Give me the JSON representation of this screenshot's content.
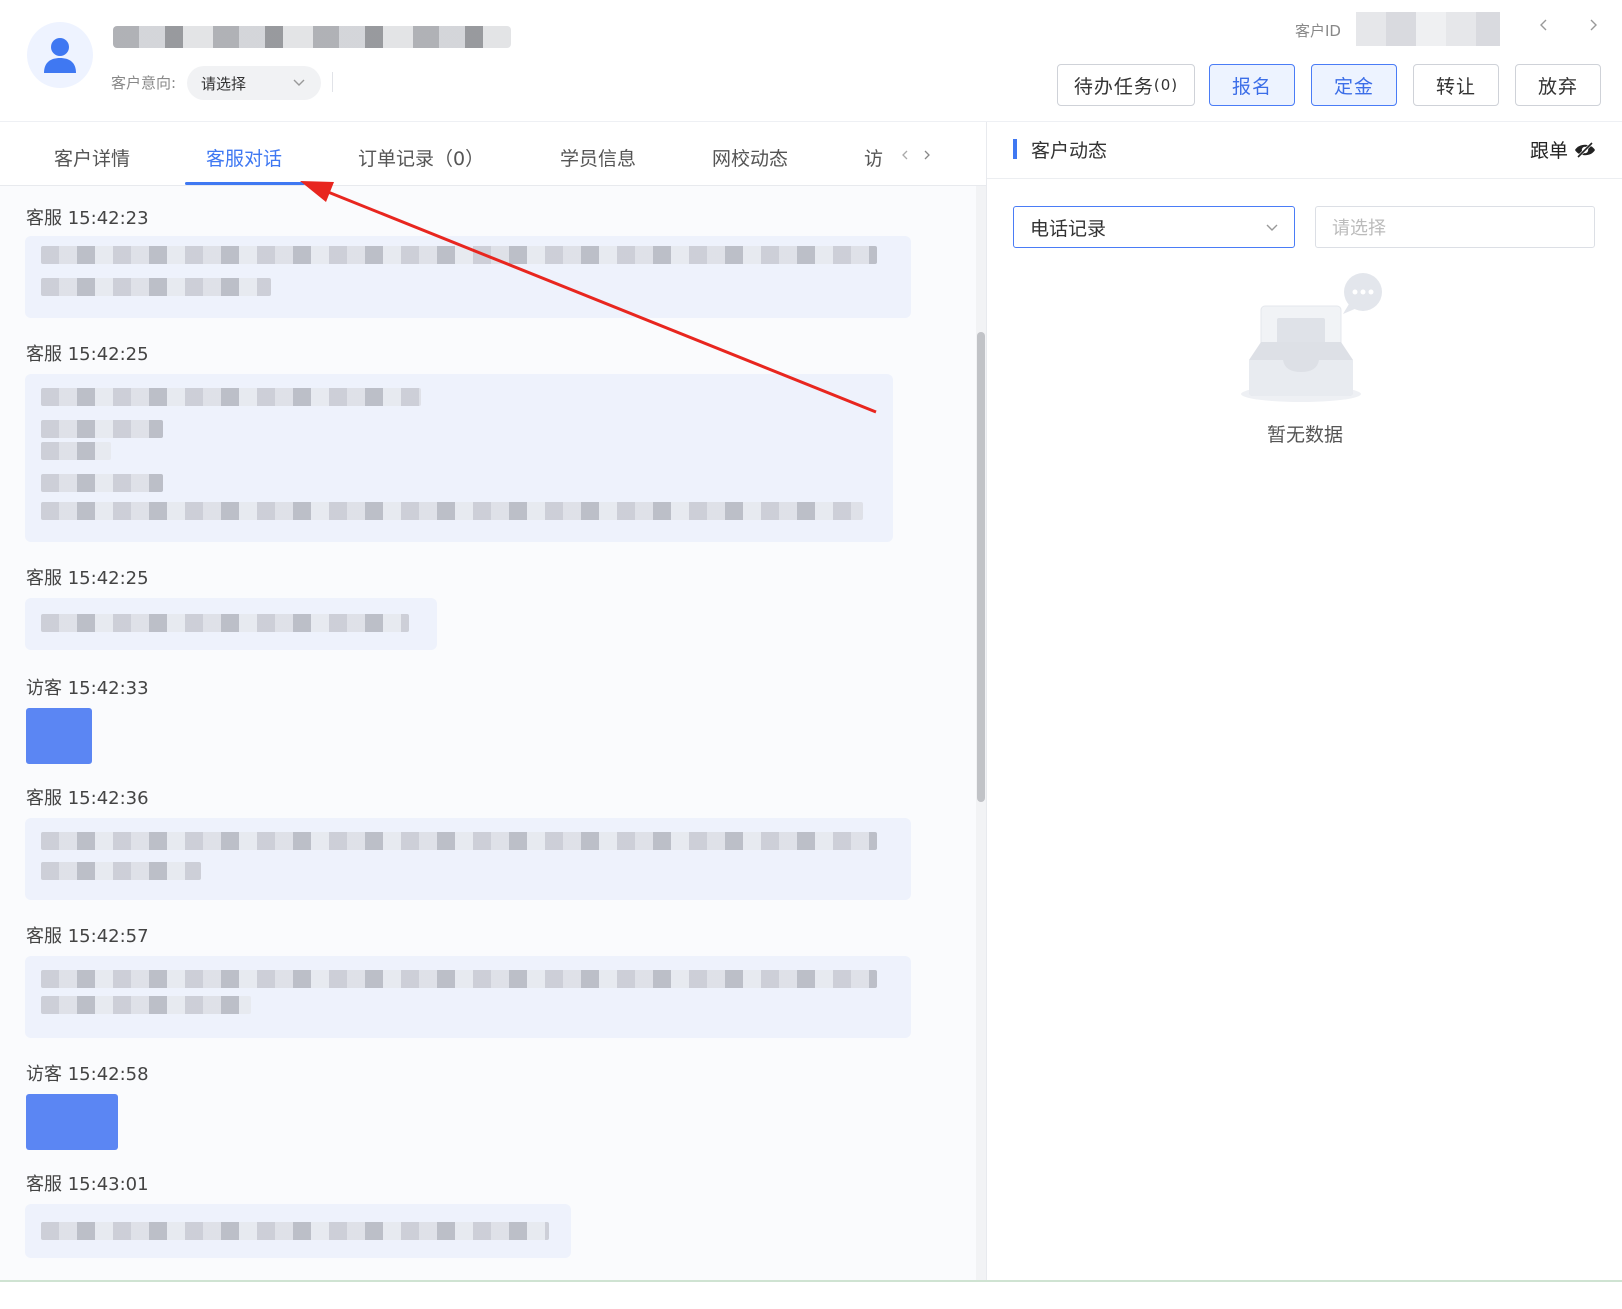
{
  "header": {
    "intent_label": "客户意向:",
    "intent_value": "请选择",
    "customer_id_label": "客户ID",
    "buttons": {
      "todo": "待办任务",
      "todo_count": "(0)",
      "signup": "报名",
      "deposit": "定金",
      "transfer": "转让",
      "abandon": "放弃"
    }
  },
  "tabs": [
    {
      "label": "客户详情"
    },
    {
      "label": "客服对话"
    },
    {
      "label": "订单记录（0）"
    },
    {
      "label": "学员信息"
    },
    {
      "label": "网校动态"
    },
    {
      "label": "访"
    }
  ],
  "chat": {
    "messages": [
      {
        "header": "客服 15:42:23"
      },
      {
        "header": "客服 15:42:25"
      },
      {
        "header": "客服 15:42:25"
      },
      {
        "header": "访客 15:42:33"
      },
      {
        "header": "客服 15:42:36"
      },
      {
        "header": "客服 15:42:57"
      },
      {
        "header": "访客 15:42:58"
      },
      {
        "header": "客服 15:43:01"
      }
    ]
  },
  "right": {
    "title": "客户动态",
    "follow_label": "跟单",
    "filter_value": "电话记录",
    "filter_placeholder": "请选择",
    "empty_text": "暂无数据"
  },
  "colors": {
    "accent": "#3f78f2",
    "annotation_arrow": "#e8261f",
    "visitor_bubble": "#5b86f3"
  }
}
